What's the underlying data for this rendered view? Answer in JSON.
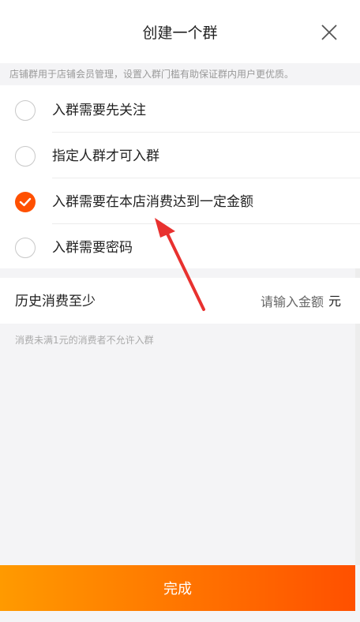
{
  "header": {
    "title": "创建一个群",
    "close_icon": "close-icon"
  },
  "notice": "店铺群用于店铺会员管理，设置入群门槛有助保证群内用户更优质。",
  "options": [
    {
      "label": "入群需要先关注",
      "checked": false
    },
    {
      "label": "指定人群才可入群",
      "checked": false
    },
    {
      "label": "入群需要在本店消费达到一定金额",
      "checked": true
    },
    {
      "label": "入群需要密码",
      "checked": false
    }
  ],
  "amount": {
    "label": "历史消费至少",
    "placeholder": "请输入金额",
    "value": "",
    "unit": "元"
  },
  "hint": "消费未满1元的消费者不允许入群",
  "footer": {
    "done_label": "完成"
  },
  "colors": {
    "accent": "#ff5000",
    "annotation_arrow": "#e8312f"
  }
}
